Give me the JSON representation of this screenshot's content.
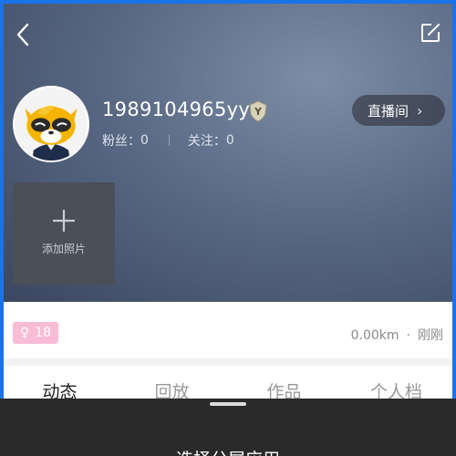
{
  "profile": {
    "username": "1989104965yy",
    "fans_label": "粉丝：",
    "fans_count": "0",
    "follow_label": "关注：",
    "follow_count": "0",
    "badge_letter": "Y"
  },
  "header": {
    "back_icon": "chevron-left-icon",
    "edit_icon": "edit-square-icon",
    "live_room_label": "直播间",
    "live_room_chevron": "›"
  },
  "photos": {
    "add_label": "添加照片"
  },
  "info": {
    "gender_symbol": "♀",
    "age": "18",
    "distance": "0.00km",
    "separator": "·",
    "time": "刚刚"
  },
  "tabs": [
    {
      "label": "动态",
      "active": true
    },
    {
      "label": "回放",
      "active": false
    },
    {
      "label": "作品",
      "active": false
    },
    {
      "label": "个人档",
      "active": false
    }
  ],
  "sheet": {
    "title": "选择分屏应用"
  },
  "colors": {
    "accent_frame": "#1a73e8",
    "gender_tag": "#f8bcd6",
    "hero_bg": "#5a6a84"
  }
}
